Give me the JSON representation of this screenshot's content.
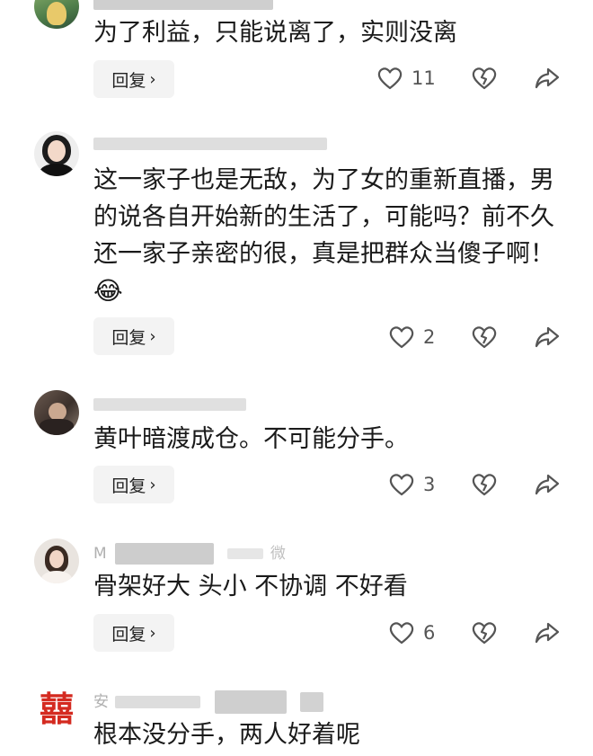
{
  "comments": [
    {
      "text": "为了利益，只能说离了，实则没离",
      "reply": "回复",
      "likes": "11"
    },
    {
      "text": "这一家子也是无敌，为了女的重新直播，男的说各自开始新的生活了，可能吗？前不久还一家子亲密的很，真是把群众当傻子啊！",
      "emoji": "😂",
      "reply": "回复",
      "likes": "2"
    },
    {
      "text": "黄叶暗渡成仓。不可能分手。",
      "reply": "回复",
      "likes": "3"
    },
    {
      "author_fragment": "M",
      "meta_tail": "微",
      "text": "骨架好大 头小 不协调 不好看",
      "reply": "回复",
      "likes": "6"
    },
    {
      "author_fragment": "安",
      "avatar_char": "囍",
      "text": "根本没分手，两人好着呢"
    }
  ],
  "icons": {
    "like": "heart-icon",
    "dislike": "broken-heart-icon",
    "share": "share-arrow-icon",
    "reply_chevron": "chevron-right-icon"
  },
  "colors": {
    "reply_bg": "#f3f3f3",
    "icon": "#555555",
    "meta": "#b5b5b5",
    "avatar_xi": "#d42a20"
  }
}
